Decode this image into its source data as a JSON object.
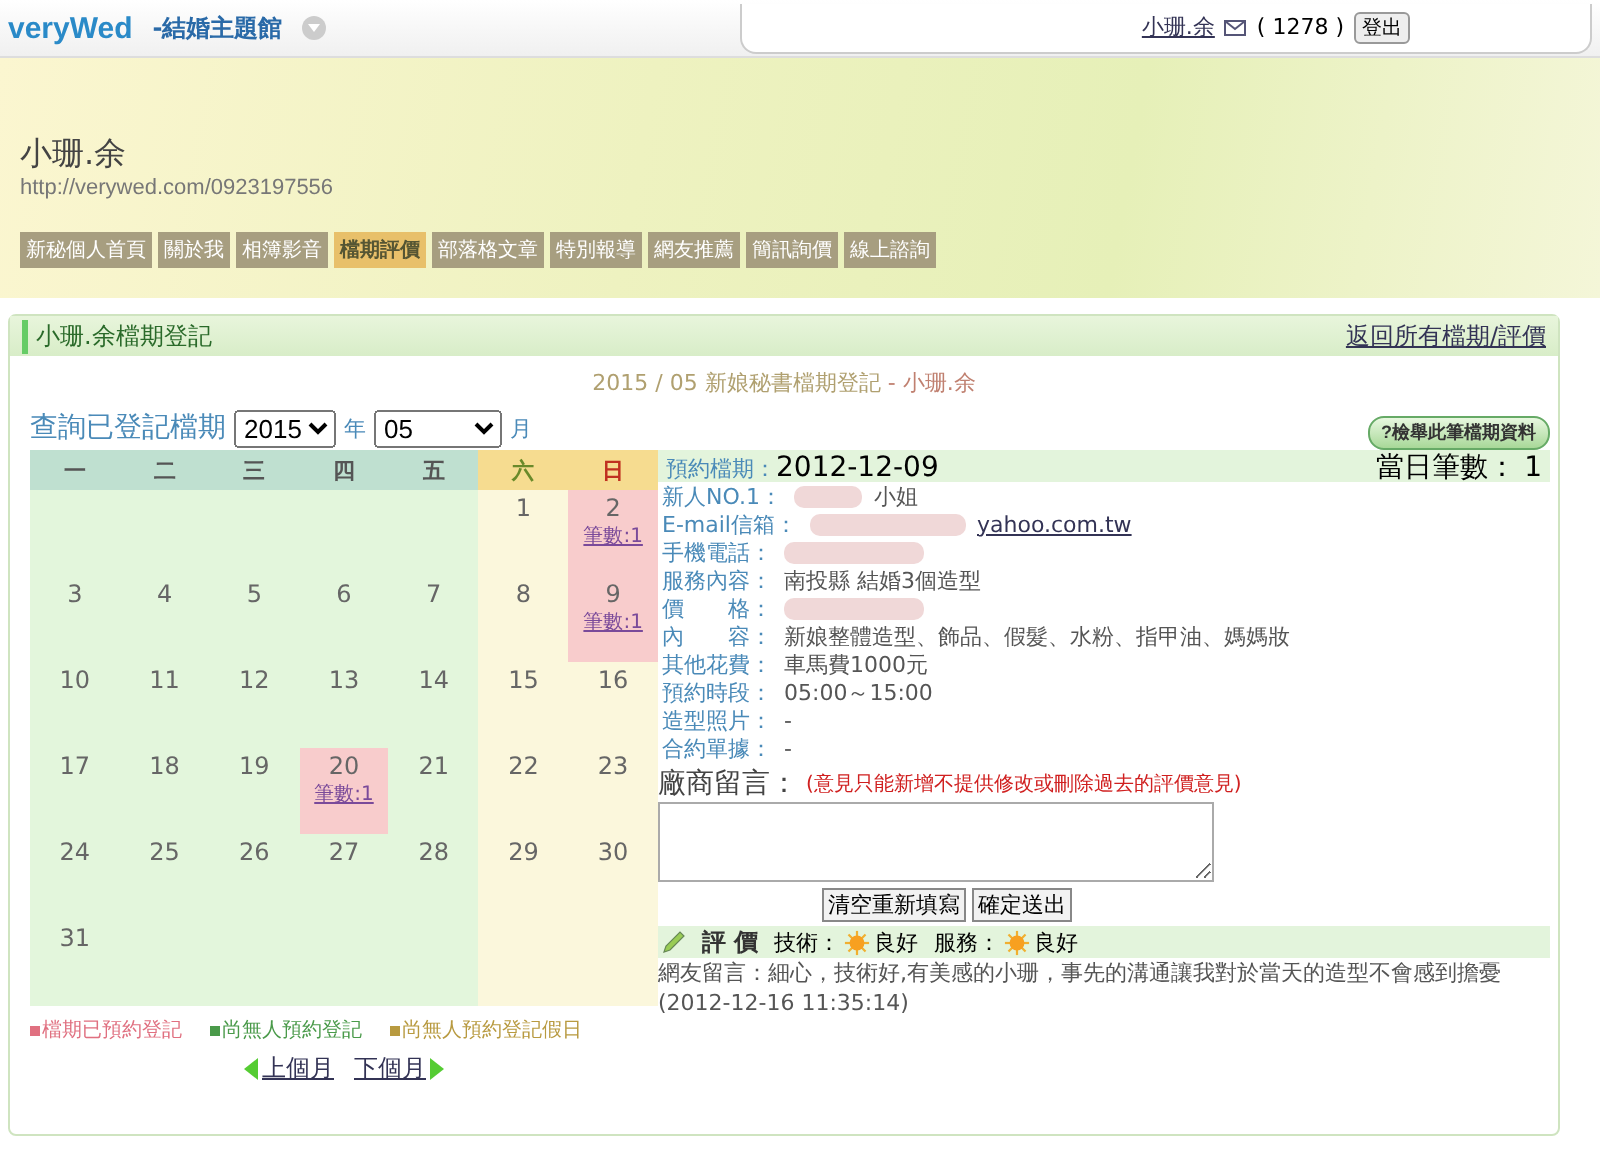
{
  "top_bar": {
    "logo": "veryWed",
    "site_menu": "-結婚主題館",
    "user": "小珊.余",
    "mail_count": "( 1278 )",
    "logout": "登出"
  },
  "banner": {
    "name": "小珊.余",
    "url": "http://verywed.com/0923197556"
  },
  "nav_tabs": [
    {
      "label": "新秘個人首頁",
      "selected": false
    },
    {
      "label": "關於我",
      "selected": false
    },
    {
      "label": "相簿影音",
      "selected": false
    },
    {
      "label": "檔期評價",
      "selected": true
    },
    {
      "label": "部落格文章",
      "selected": false
    },
    {
      "label": "特別報導",
      "selected": false
    },
    {
      "label": "網友推薦",
      "selected": false
    },
    {
      "label": "簡訊詢價",
      "selected": false
    },
    {
      "label": "線上諮詢",
      "selected": false
    }
  ],
  "section": {
    "title": "小珊.余檔期登記",
    "back_link": "返回所有檔期/評價",
    "subtitle": "2015 / 05 新娘秘書檔期登記",
    "subtitle_name": " - 小珊.余"
  },
  "query": {
    "label": "查詢已登記檔期",
    "year": "2015",
    "year_unit": "年",
    "month": "05",
    "month_unit": "月",
    "report_button": "?檢舉此筆檔期資料"
  },
  "calendar": {
    "weekdays": [
      {
        "label": "一",
        "kind": "weekday"
      },
      {
        "label": "二",
        "kind": "weekday"
      },
      {
        "label": "三",
        "kind": "weekday"
      },
      {
        "label": "四",
        "kind": "weekday"
      },
      {
        "label": "五",
        "kind": "weekday"
      },
      {
        "label": "六",
        "kind": "saturday"
      },
      {
        "label": "日",
        "kind": "sunday"
      }
    ],
    "weeks": [
      [
        {
          "day": "1",
          "booked": false
        },
        {
          "day": "2",
          "booked": true,
          "count": "筆數:1"
        }
      ],
      [
        {
          "day": "3",
          "booked": false
        },
        {
          "day": "4",
          "booked": false
        },
        {
          "day": "5",
          "booked": false
        },
        {
          "day": "6",
          "booked": false
        },
        {
          "day": "7",
          "booked": false
        },
        {
          "day": "8",
          "booked": false
        },
        {
          "day": "9",
          "booked": true,
          "count": "筆數:1"
        }
      ],
      [
        {
          "day": "10",
          "booked": false
        },
        {
          "day": "11",
          "booked": false
        },
        {
          "day": "12",
          "booked": false
        },
        {
          "day": "13",
          "booked": false
        },
        {
          "day": "14",
          "booked": false
        },
        {
          "day": "15",
          "booked": false
        },
        {
          "day": "16",
          "booked": false
        }
      ],
      [
        {
          "day": "17",
          "booked": false
        },
        {
          "day": "18",
          "booked": false
        },
        {
          "day": "19",
          "booked": false
        },
        {
          "day": "20",
          "booked": true,
          "count": "筆數:1"
        },
        {
          "day": "21",
          "booked": false
        },
        {
          "day": "22",
          "booked": false
        },
        {
          "day": "23",
          "booked": false
        }
      ],
      [
        {
          "day": "24",
          "booked": false
        },
        {
          "day": "25",
          "booked": false
        },
        {
          "day": "26",
          "booked": false
        },
        {
          "day": "27",
          "booked": false
        },
        {
          "day": "28",
          "booked": false
        },
        {
          "day": "29",
          "booked": false
        },
        {
          "day": "30",
          "booked": false
        }
      ],
      [
        {
          "day": "31",
          "booked": false
        }
      ]
    ],
    "legend": [
      {
        "label": "檔期已預約登記",
        "color": "#e07080"
      },
      {
        "label": "尚無人預約登記",
        "color": "#4a9a4a"
      },
      {
        "label": "尚無人預約登記假日",
        "color": "#b89a40"
      }
    ],
    "prev": "上個月",
    "next": "下個月"
  },
  "booking": {
    "date_label": "預約檔期：",
    "date": "2012-12-09",
    "count_label": "當日筆數：",
    "count": "1",
    "fields": [
      {
        "label": "新人NO.1：",
        "value": "小姐",
        "kind": "blurred_prefix"
      },
      {
        "label": "E-mail信箱：",
        "value": "yahoo.com.tw",
        "kind": "blurred_link"
      },
      {
        "label": "手機電話：",
        "kind": "blurred"
      },
      {
        "label": "服務內容：",
        "value": "南投縣 結婚3個造型",
        "kind": "text"
      },
      {
        "label": "價　　格：",
        "kind": "blurred"
      },
      {
        "label": "內　　容：",
        "value": "新娘整體造型、飾品、假髮、水粉、指甲油、媽媽妝",
        "kind": "text"
      },
      {
        "label": "其他花費：",
        "value": "車馬費1000元",
        "kind": "text"
      },
      {
        "label": "預約時段：",
        "value": "05:00～15:00",
        "kind": "text"
      },
      {
        "label": "造型照片：",
        "value": "-",
        "kind": "text"
      },
      {
        "label": "合約單據：",
        "value": "-",
        "kind": "text"
      }
    ],
    "message_label": "廠商留言：",
    "message_note": "(意見只能新增不提供修改或刪除過去的評價意見)",
    "buttons": [
      "清空重新填寫",
      "確定送出"
    ],
    "rating": {
      "title": "評 價",
      "items": [
        {
          "label": "技術：",
          "value": "良好"
        },
        {
          "label": "服務：",
          "value": "良好"
        }
      ]
    },
    "comment": "網友留言：細心，技術好,有美感的小珊，事先的溝通讓我對於當天的造型不會感到擔憂　(2012-12-16 11:35:14)"
  }
}
